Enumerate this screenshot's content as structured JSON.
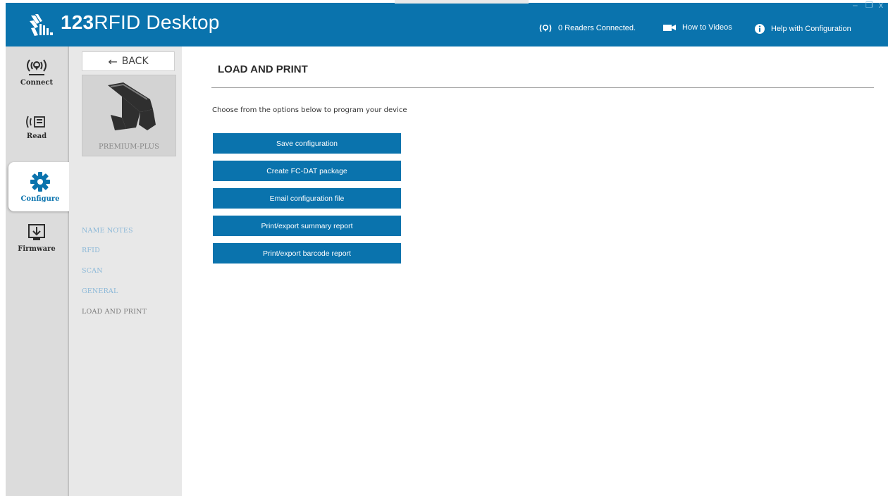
{
  "header": {
    "brand_number": "123",
    "brand_name": "RFID Desktop",
    "readers_status": "0 Readers Connected.",
    "how_to_videos": "How to Videos",
    "help_config": "Help with Configuration",
    "window_controls": [
      "–",
      "❐",
      "x"
    ]
  },
  "nav": {
    "items": [
      {
        "label": "Connect",
        "icon": "connect-icon"
      },
      {
        "label": "Read",
        "icon": "read-icon"
      },
      {
        "label": "Configure",
        "icon": "gear-icon",
        "active": true
      },
      {
        "label": "Firmware",
        "icon": "firmware-icon"
      }
    ]
  },
  "sub": {
    "back_label": "BACK",
    "device_name": "PREMIUM-PLUS",
    "items": [
      {
        "label": "NAME NOTES"
      },
      {
        "label": "RFID"
      },
      {
        "label": "SCAN"
      },
      {
        "label": "GENERAL"
      },
      {
        "label": "LOAD AND PRINT",
        "current": true
      }
    ]
  },
  "main": {
    "title": "LOAD AND PRINT",
    "description": "Choose from the options below to program your device",
    "buttons": [
      "Save configuration",
      "Create FC-DAT package",
      "Email configuration file",
      "Print/export summary report",
      "Print/export barcode report"
    ]
  },
  "colors": {
    "brand_blue": "#0a73ad",
    "nav_bg": "#dcdcdc",
    "panel_bg": "#e8e8e8",
    "sub_link": "#8bb8d8"
  }
}
